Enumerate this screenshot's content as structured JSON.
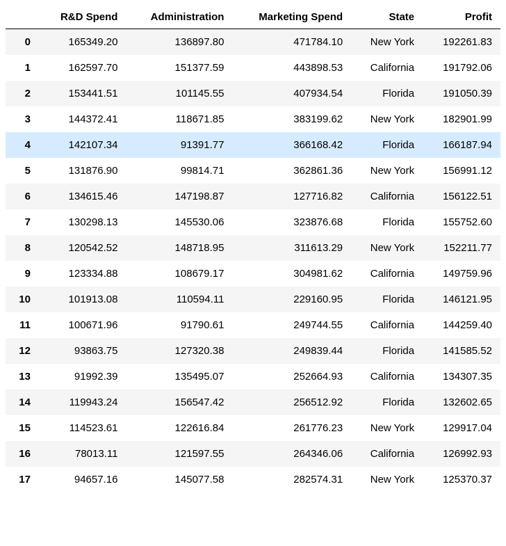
{
  "chart_data": {
    "type": "table",
    "columns": [
      "R&D Spend",
      "Administration",
      "Marketing Spend",
      "State",
      "Profit"
    ],
    "index": [
      "0",
      "1",
      "2",
      "3",
      "4",
      "5",
      "6",
      "7",
      "8",
      "9",
      "10",
      "11",
      "12",
      "13",
      "14",
      "15",
      "16",
      "17"
    ],
    "highlighted_row": 4,
    "rows": [
      {
        "rd": "165349.20",
        "admin": "136897.80",
        "mkt": "471784.10",
        "state": "New York",
        "profit": "192261.83"
      },
      {
        "rd": "162597.70",
        "admin": "151377.59",
        "mkt": "443898.53",
        "state": "California",
        "profit": "191792.06"
      },
      {
        "rd": "153441.51",
        "admin": "101145.55",
        "mkt": "407934.54",
        "state": "Florida",
        "profit": "191050.39"
      },
      {
        "rd": "144372.41",
        "admin": "118671.85",
        "mkt": "383199.62",
        "state": "New York",
        "profit": "182901.99"
      },
      {
        "rd": "142107.34",
        "admin": "91391.77",
        "mkt": "366168.42",
        "state": "Florida",
        "profit": "166187.94"
      },
      {
        "rd": "131876.90",
        "admin": "99814.71",
        "mkt": "362861.36",
        "state": "New York",
        "profit": "156991.12"
      },
      {
        "rd": "134615.46",
        "admin": "147198.87",
        "mkt": "127716.82",
        "state": "California",
        "profit": "156122.51"
      },
      {
        "rd": "130298.13",
        "admin": "145530.06",
        "mkt": "323876.68",
        "state": "Florida",
        "profit": "155752.60"
      },
      {
        "rd": "120542.52",
        "admin": "148718.95",
        "mkt": "311613.29",
        "state": "New York",
        "profit": "152211.77"
      },
      {
        "rd": "123334.88",
        "admin": "108679.17",
        "mkt": "304981.62",
        "state": "California",
        "profit": "149759.96"
      },
      {
        "rd": "101913.08",
        "admin": "110594.11",
        "mkt": "229160.95",
        "state": "Florida",
        "profit": "146121.95"
      },
      {
        "rd": "100671.96",
        "admin": "91790.61",
        "mkt": "249744.55",
        "state": "California",
        "profit": "144259.40"
      },
      {
        "rd": "93863.75",
        "admin": "127320.38",
        "mkt": "249839.44",
        "state": "Florida",
        "profit": "141585.52"
      },
      {
        "rd": "91992.39",
        "admin": "135495.07",
        "mkt": "252664.93",
        "state": "California",
        "profit": "134307.35"
      },
      {
        "rd": "119943.24",
        "admin": "156547.42",
        "mkt": "256512.92",
        "state": "Florida",
        "profit": "132602.65"
      },
      {
        "rd": "114523.61",
        "admin": "122616.84",
        "mkt": "261776.23",
        "state": "New York",
        "profit": "129917.04"
      },
      {
        "rd": "78013.11",
        "admin": "121597.55",
        "mkt": "264346.06",
        "state": "California",
        "profit": "126992.93"
      },
      {
        "rd": "94657.16",
        "admin": "145077.58",
        "mkt": "282574.31",
        "state": "New York",
        "profit": "125370.37"
      }
    ]
  }
}
